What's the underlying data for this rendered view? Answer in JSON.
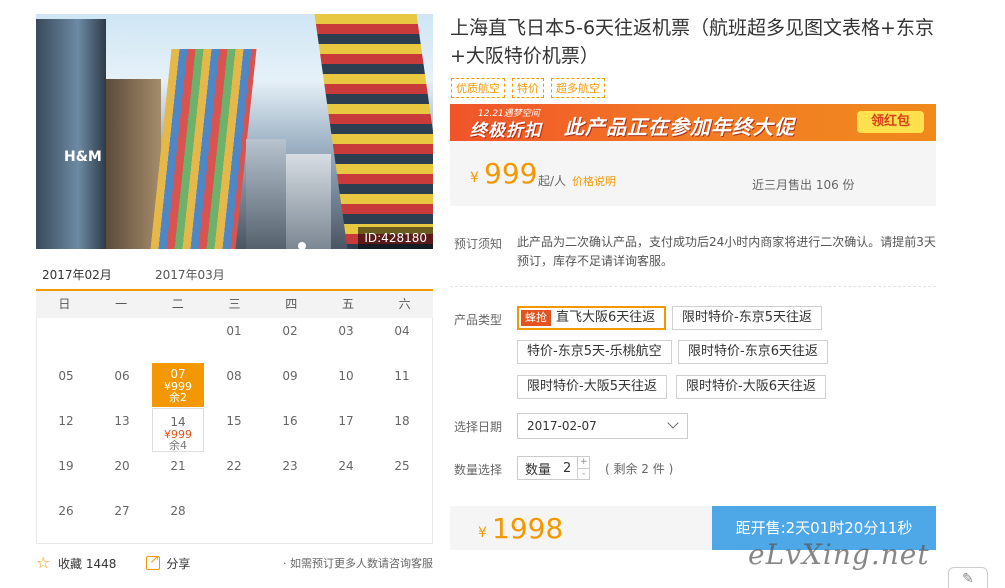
{
  "photo": {
    "id_label": "ID:428180",
    "sign": "H&M"
  },
  "calendar": {
    "tabs": [
      "2017年02月",
      "2017年03月"
    ],
    "weekdays": [
      "日",
      "一",
      "二",
      "三",
      "四",
      "五",
      "六"
    ],
    "days": [
      "01",
      "02",
      "03",
      "04",
      "05",
      "06",
      "07",
      "08",
      "09",
      "10",
      "11",
      "12",
      "13",
      "14",
      "15",
      "16",
      "17",
      "18",
      "19",
      "20",
      "21",
      "22",
      "23",
      "24",
      "25",
      "26",
      "27",
      "28"
    ],
    "selected": {
      "day": "07",
      "price": "¥999",
      "remain": "余2"
    },
    "available": {
      "day": "14",
      "price": "¥999",
      "remain": "余4"
    }
  },
  "footer": {
    "fav_label": "收藏 1448",
    "share_label": "分享",
    "note": "· 如需预订更多人数请咨询客服"
  },
  "product": {
    "title": "上海直飞日本5-6天往返机票（航班超多见图文表格+东京+大阪特价机票）",
    "tags": [
      "优质航空",
      "特价",
      "超多航空"
    ]
  },
  "banner": {
    "mini": "12.21遇梦空间",
    "big": "终极折扣",
    "main": "此产品正在参加年终大促",
    "button": "领红包"
  },
  "price": {
    "currency": "¥",
    "amount": "999",
    "per": "起/人",
    "link": "价格说明",
    "sold": "近三月售出 106 份"
  },
  "notice": {
    "label": "预订须知",
    "text": "此产品为二次确认产品，支付成功后24小时内商家将进行二次确认。请提前3天预订，库存不足请详询客服。"
  },
  "options": {
    "label": "产品类型",
    "flash": "蜂抢",
    "items": [
      "直飞大阪6天往返",
      "限时特价-东京5天往返",
      "特价-东京5天-乐桃航空",
      "限时特价-东京6天往返",
      "限时特价-大阪5天往返",
      "限时特价-大阪6天往返"
    ]
  },
  "date": {
    "label": "选择日期",
    "value": "2017-02-07"
  },
  "quantity": {
    "label": "数量选择",
    "field_label": "数量",
    "value": "2",
    "plus": "+",
    "minus": "-",
    "remain": "( 剩余 2 件 )"
  },
  "total": {
    "currency": "¥",
    "amount": "1998"
  },
  "countdown": "距开售:2天01时20分11秒",
  "watermark": "eLvXing.net",
  "colors": {
    "accent": "#f39800",
    "price": "#f39800",
    "countdown_bg": "#4ea8e8",
    "flash_bg": "#e4531f"
  }
}
